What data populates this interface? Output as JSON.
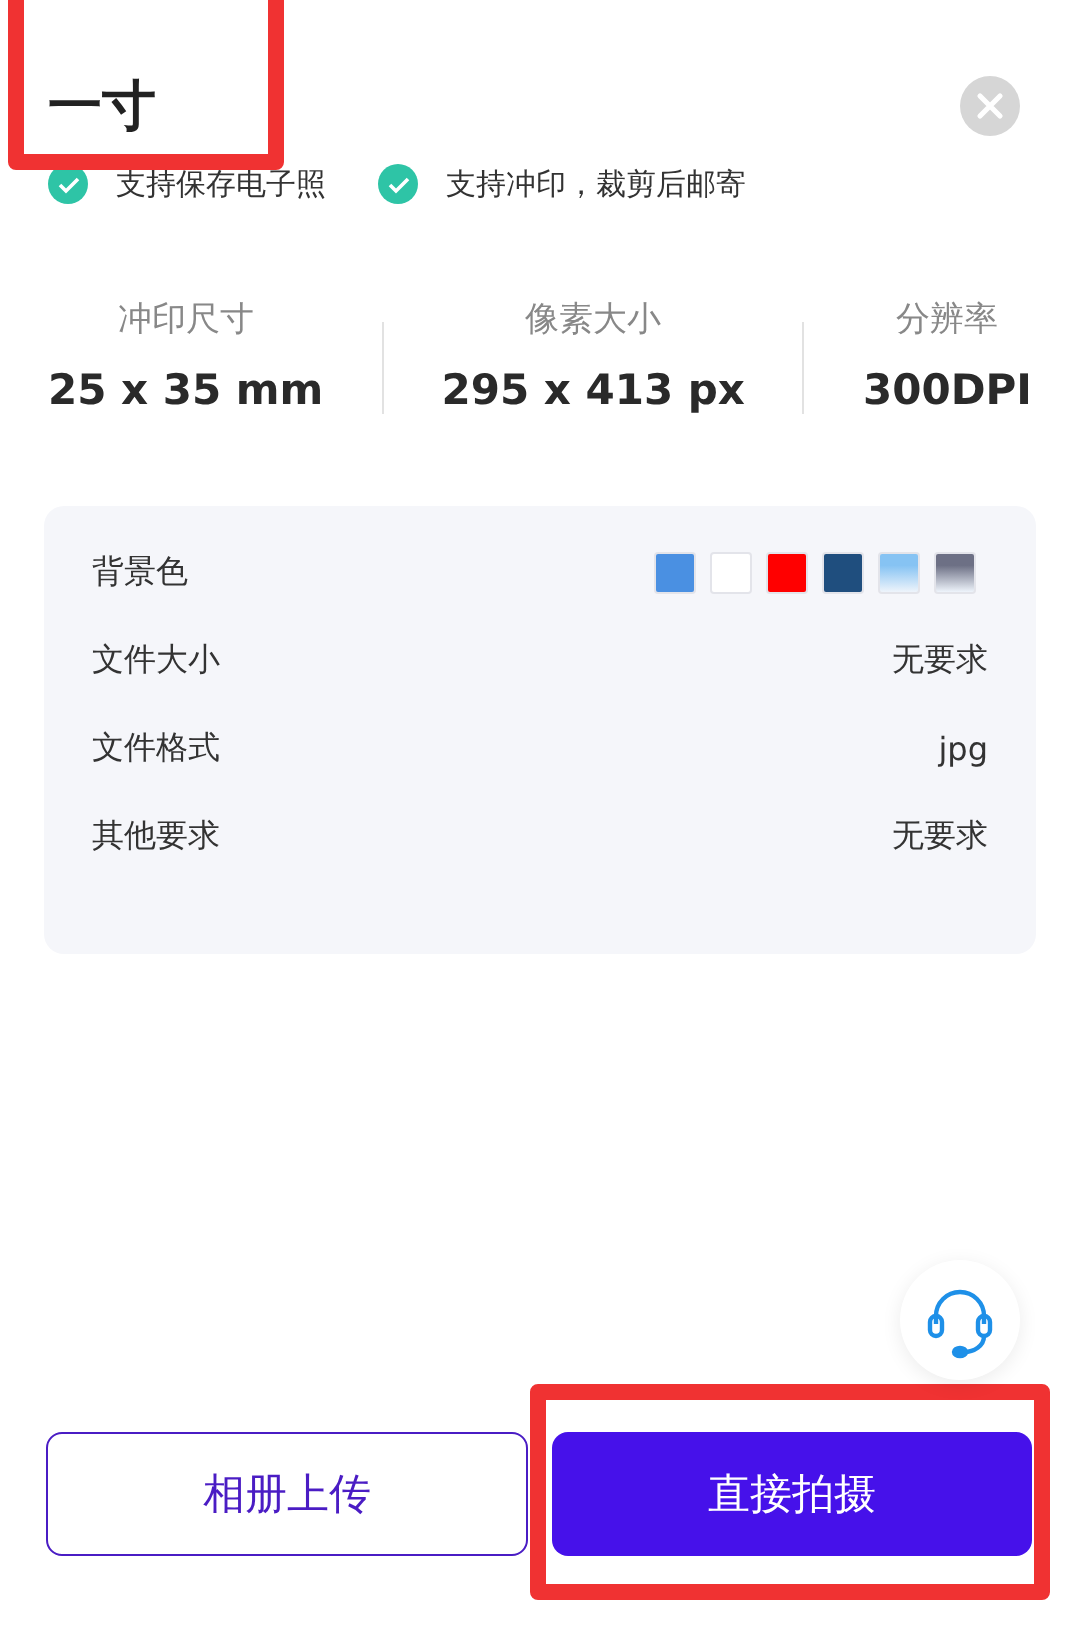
{
  "title": {
    "text": "一寸",
    "highlighted": true
  },
  "features": [
    {
      "label": "支持保存电子照",
      "checked": true
    },
    {
      "label": "支持冲印，裁剪后邮寄",
      "checked": true
    }
  ],
  "stats": [
    {
      "label": "冲印尺寸",
      "value": "25 x 35 mm"
    },
    {
      "label": "像素大小",
      "value": "295 x 413 px"
    },
    {
      "label": "分辨率",
      "value": "300DPI"
    }
  ],
  "specs": {
    "background_label": "背景色",
    "swatches": [
      {
        "kind": "solid",
        "color": "#4a90e2"
      },
      {
        "kind": "solid",
        "color": "#ffffff"
      },
      {
        "kind": "solid",
        "color": "#ff0000"
      },
      {
        "kind": "solid",
        "color": "#1f4e7e"
      },
      {
        "kind": "gradient",
        "color": "#86c3f3"
      },
      {
        "kind": "gradient",
        "color": "#6d7085"
      }
    ],
    "rows": [
      {
        "label": "文件大小",
        "value": "无要求"
      },
      {
        "label": "文件格式",
        "value": "jpg"
      },
      {
        "label": "其他要求",
        "value": "无要求"
      }
    ]
  },
  "buttons": [
    {
      "label": "相册上传",
      "kind": "outline"
    },
    {
      "label": "直接拍摄",
      "kind": "primary",
      "highlighted": true
    }
  ]
}
